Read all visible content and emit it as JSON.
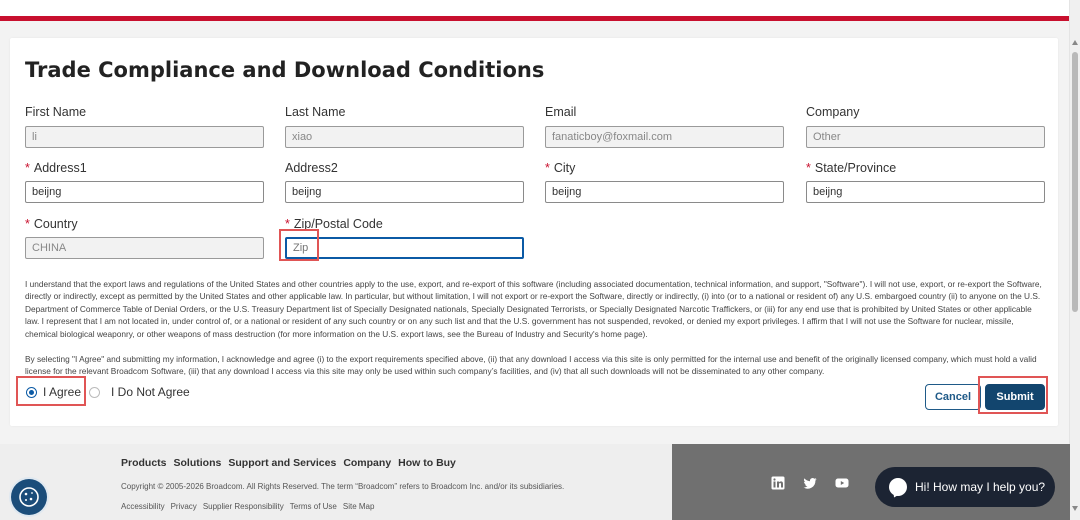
{
  "form": {
    "title": "Trade Compliance and Download Conditions",
    "fields": {
      "first_name": {
        "label": "First Name",
        "value": "li"
      },
      "last_name": {
        "label": "Last Name",
        "value": "xiao"
      },
      "email": {
        "label": "Email",
        "value": "fanaticboy@foxmail.com"
      },
      "company": {
        "label": "Company",
        "value": "Other"
      },
      "address1": {
        "label": "Address1",
        "value": "beijng",
        "required": "*"
      },
      "address2": {
        "label": "Address2",
        "value": "beijng"
      },
      "city": {
        "label": "City",
        "value": "beijng",
        "required": "*"
      },
      "state": {
        "label": "State/Province",
        "value": "beijng",
        "required": "*"
      },
      "country": {
        "label": "Country",
        "value": "CHINA",
        "required": "*"
      },
      "zip": {
        "label": "Zip/Postal Code",
        "value": "",
        "placeholder": "Zip",
        "required": "*"
      }
    },
    "legal_text_1": "I understand that the export laws and regulations of the United States and other countries apply to the use, export, and re-export of this software (including associated documentation, technical information, and support, \"Software\"). I will not use, export, or re-export the Software, directly or indirectly, except as permitted by the United States and other applicable law. In particular, but without limitation, I will not export or re-export the Software, directly or indirectly, (i) into (or to a national or resident of) any U.S. embargoed country (ii) to anyone on the U.S. Department of Commerce Table of Denial Orders, or the U.S. Treasury Department list of Specially Designated nationals, Specially Designated Terrorists, or Specially Designated Narcotic Traffickers, or (iii) for any end use that is prohibited by United States or other applicable law. I represent that I am not located in, under control of, or a national or resident of any such country or on any such list and that the U.S. government has not suspended, revoked, or denied my export privileges. I affirm that I will not use the Software for nuclear, missile, chemical biological weaponry, or other weapons of mass destruction (for more information on the U.S. export laws, see the Bureau of Industry and Security's home page).",
    "legal_text_2": "By selecting \"I Agree\" and submitting my information, I acknowledge and agree (i) to the export requirements specified above, (ii) that any download I access via this site is only permitted for the internal use and benefit of the originally licensed company, which must hold a valid license for the relevant Broadcom Software, (iii) that any download I access via this site may only be used within such company’s facilities, and (iv) that all such downloads will not be disseminated to any other company.",
    "agree_label": "I Agree",
    "disagree_label": "I Do Not Agree",
    "cancel_label": "Cancel",
    "submit_label": "Submit"
  },
  "footer": {
    "nav": [
      "Products",
      "Solutions",
      "Support and Services",
      "Company",
      "How to Buy"
    ],
    "copyright": "Copyright © 2005-2026 Broadcom. All Rights Reserved. The term “Broadcom” refers to Broadcom Inc. and/or its subsidiaries.",
    "links": [
      "Accessibility",
      "Privacy",
      "Supplier Responsibility",
      "Terms of Use",
      "Site Map"
    ],
    "social": [
      "linkedin-icon",
      "twitter-icon",
      "youtube-icon"
    ]
  },
  "chat": {
    "label": "Hi! How may I help you?"
  },
  "colors": {
    "brand_red": "#c8102e",
    "primary_blue": "#12456e",
    "focus_blue": "#0b5aa5",
    "highlight": "#e05555"
  }
}
